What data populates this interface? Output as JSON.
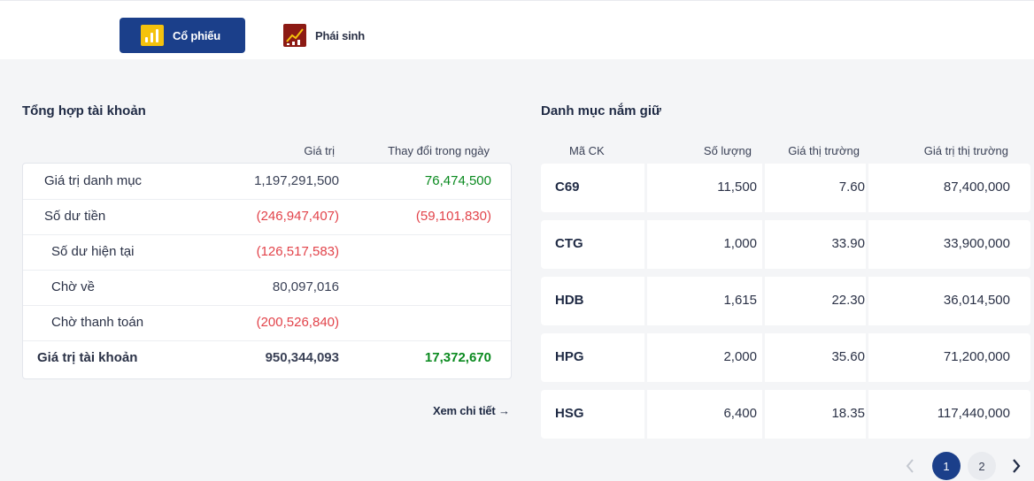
{
  "tabs": [
    {
      "label": "Cổ phiếu",
      "icon": "stock-chart-icon",
      "active": true
    },
    {
      "label": "Phái sinh",
      "icon": "derivative-chart-icon",
      "active": false
    }
  ],
  "summary": {
    "title": "Tổng hợp tài khoản",
    "col_value": "Giá trị",
    "col_change": "Thay đổi trong ngày",
    "rows": [
      {
        "label": "Giá trị danh mục",
        "value": "1,197,291,500",
        "change": "76,474,500"
      },
      {
        "label": "Số dư tiền",
        "value": "(246,947,407)",
        "change": "(59,101,830)"
      },
      {
        "label": "Số dư hiện tại",
        "value": "(126,517,583)",
        "change": ""
      },
      {
        "label": "Chờ về",
        "value": "80,097,016",
        "change": ""
      },
      {
        "label": "Chờ thanh toán",
        "value": "(200,526,840)",
        "change": ""
      },
      {
        "label": "Giá trị tài khoản",
        "value": "950,344,093",
        "change": "17,372,670"
      }
    ],
    "detail_link": "Xem chi tiết"
  },
  "holdings": {
    "title": "Danh mục nắm giữ",
    "columns": [
      "Mã CK",
      "Số lượng",
      "Giá thị trường",
      "Giá trị thị trường"
    ],
    "rows": [
      {
        "symbol": "C69",
        "qty": "11,500",
        "price": "7.60",
        "market_value": "87,400,000"
      },
      {
        "symbol": "CTG",
        "qty": "1,000",
        "price": "33.90",
        "market_value": "33,900,000"
      },
      {
        "symbol": "HDB",
        "qty": "1,615",
        "price": "22.30",
        "market_value": "36,014,500"
      },
      {
        "symbol": "HPG",
        "qty": "2,000",
        "price": "35.60",
        "market_value": "71,200,000"
      },
      {
        "symbol": "HSG",
        "qty": "6,400",
        "price": "18.35",
        "market_value": "117,440,000"
      }
    ]
  },
  "pagination": {
    "pages": [
      "1",
      "2"
    ],
    "current": "1"
  },
  "colors": {
    "primary": "#1b3f8a",
    "negative": "#e2434a",
    "positive": "#0a8a1f"
  }
}
